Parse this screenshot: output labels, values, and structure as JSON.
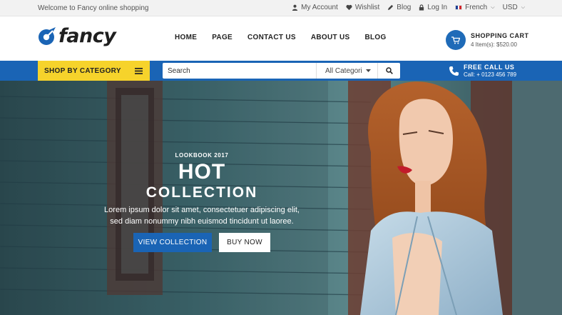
{
  "topbar": {
    "welcome": "Welcome to Fancy online shopping",
    "my_account": "My Account",
    "wishlist": "Wishlist",
    "blog": "Blog",
    "login": "Log In",
    "language": "French",
    "currency": "USD"
  },
  "header": {
    "logo_text": "fancy",
    "nav": [
      "HOME",
      "PAGE",
      "CONTACT US",
      "ABOUT US",
      "BLOG"
    ],
    "cart_title": "SHOPPING CART",
    "cart_summary": "4 Item(s): $520.00"
  },
  "catbar": {
    "shop_by_category": "SHOP BY CATEGORY",
    "search_placeholder": "Search",
    "category_select": "All Categori",
    "call_title": "FREE CALL US",
    "call_number": "Call: + 0123 456 789"
  },
  "hero": {
    "kicker": "LOOKBOOK 2017",
    "headline": "HOT",
    "subheadline": "COLLECTION",
    "desc_line1": "Lorem ipsum dolor sit amet, consectetuer adipiscing elit,",
    "desc_line2": "sed diam nonummy nibh euismod tincidunt ut laoree.",
    "cta_primary": "VIEW COLLECTION",
    "cta_secondary": "BUY NOW"
  },
  "colors": {
    "brand_blue": "#1a64b5",
    "category_yellow": "#f6d32b",
    "topbar_bg": "#f2f2f2"
  },
  "icons": [
    "user-icon",
    "heart-icon",
    "blog-icon",
    "lock-icon",
    "flag-icon",
    "cart-icon",
    "menu-icon",
    "search-icon",
    "phone-icon"
  ]
}
